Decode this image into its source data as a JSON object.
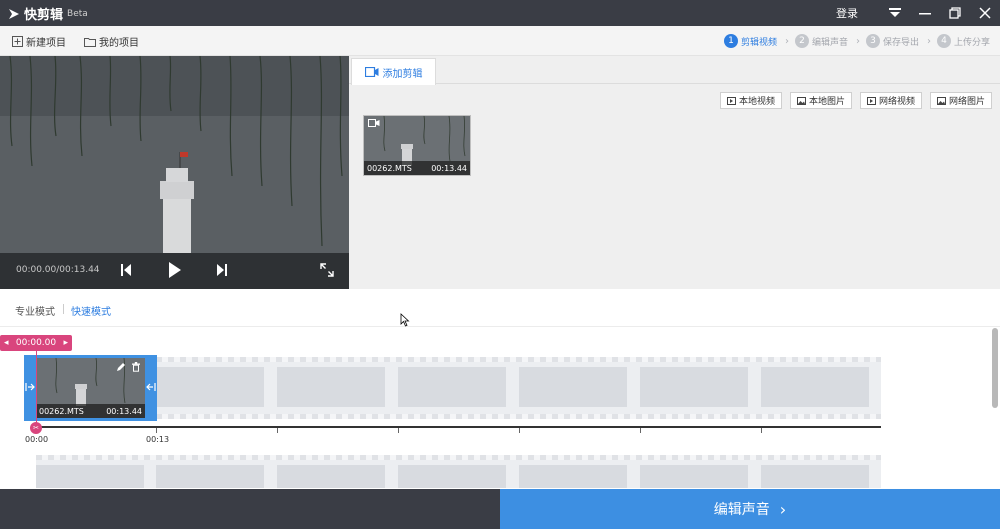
{
  "titlebar": {
    "app_name": "快剪辑",
    "beta": "Beta",
    "login": "登录",
    "icons": [
      "dropdown-icon",
      "minimize-icon",
      "restore-icon",
      "close-icon"
    ]
  },
  "toolbar": {
    "new_project": "新建项目",
    "my_projects": "我的项目",
    "steps": [
      {
        "num": "1",
        "label": "剪辑视频",
        "active": true
      },
      {
        "num": "2",
        "label": "编辑声音",
        "active": false
      },
      {
        "num": "3",
        "label": "保存导出",
        "active": false
      },
      {
        "num": "4",
        "label": "上传分享",
        "active": false
      }
    ]
  },
  "player": {
    "timecode": "00:00.00/00:13.44"
  },
  "media": {
    "tab_label": "添加剪辑",
    "source_buttons": [
      "本地视频",
      "本地图片",
      "网络视频",
      "网络图片"
    ],
    "clip": {
      "name": "00262.MTS",
      "duration": "00:13.44"
    }
  },
  "modes": {
    "pro": "专业模式",
    "quick": "快速模式"
  },
  "timeline": {
    "playhead": "00:00.00",
    "clip": {
      "name": "00262.MTS",
      "duration": "00:13.44"
    },
    "tick_labels": [
      "00:00",
      "00:13"
    ]
  },
  "footer": {
    "next_label": "编辑声音"
  },
  "colors": {
    "accent": "#2d7de0",
    "playhead": "#d9457d",
    "titlebar": "#3a3d45"
  }
}
